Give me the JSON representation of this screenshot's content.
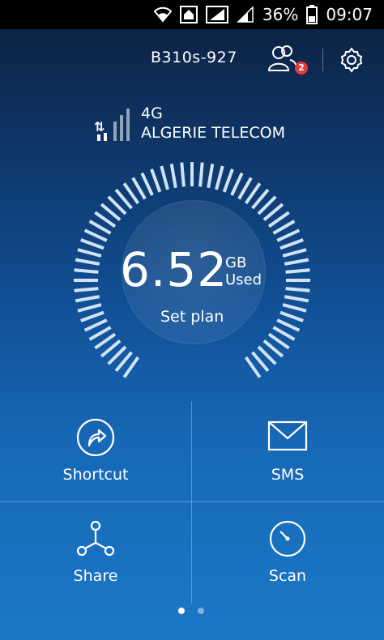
{
  "status_bar": {
    "battery": "36%",
    "time": "09:07"
  },
  "header": {
    "device_name": "B310s-927",
    "users_badge": "2"
  },
  "network": {
    "type": "4G",
    "operator": "ALGERIE TELECOM"
  },
  "usage": {
    "value": "6.52",
    "unit_line1": "GB",
    "unit_line2": "Used",
    "action": "Set plan"
  },
  "tiles": [
    {
      "label": "Shortcut",
      "icon": "shortcut-icon"
    },
    {
      "label": "SMS",
      "icon": "envelope-icon"
    },
    {
      "label": "Share",
      "icon": "share-icon"
    },
    {
      "label": "Scan",
      "icon": "scan-icon"
    }
  ],
  "pager": {
    "pages": 2,
    "active": 0
  }
}
